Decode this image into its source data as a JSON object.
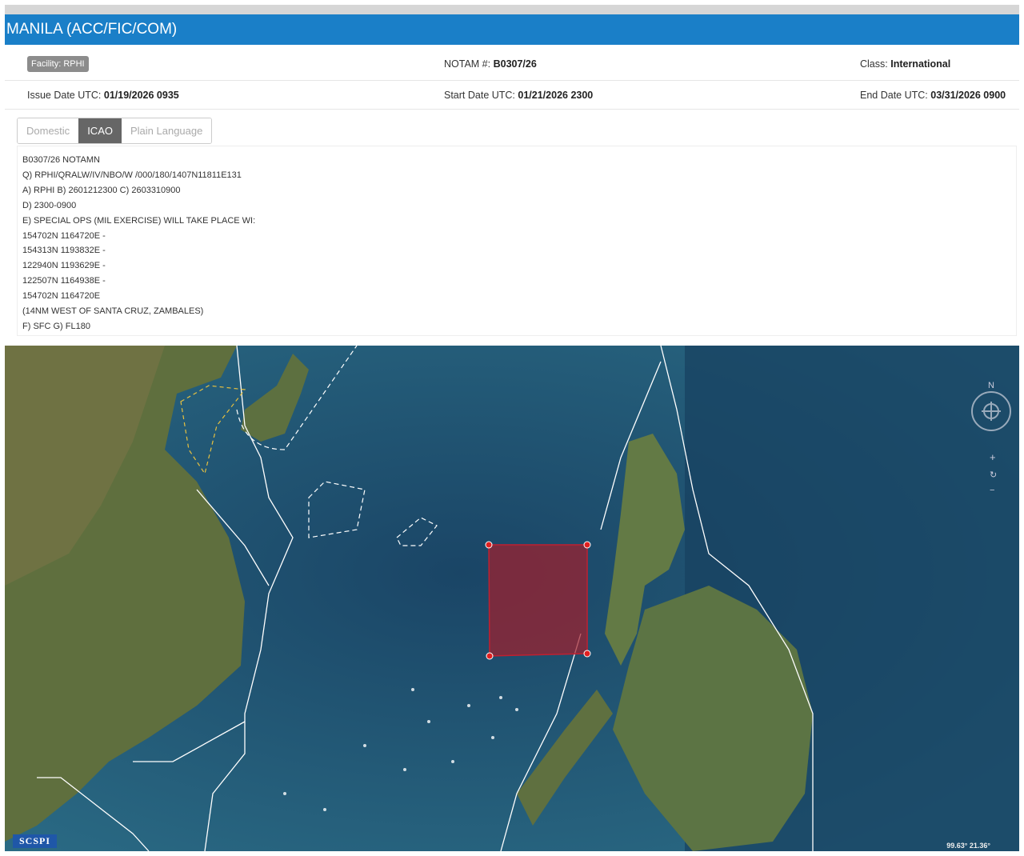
{
  "header": {
    "title": "MANILA (ACC/FIC/COM)"
  },
  "info": {
    "facility": "Facility: RPHI",
    "notam_label": "NOTAM #:",
    "notam_value": "B0307/26",
    "class_label": "Class:",
    "class_value": "International",
    "issue_label": "Issue Date UTC:",
    "issue_value": "01/19/2026 0935",
    "start_label": "Start Date UTC:",
    "start_value": "01/21/2026 2300",
    "end_label": "End Date UTC:",
    "end_value": "03/31/2026 0900"
  },
  "tabs": [
    "Domestic",
    "ICAO",
    "Plain Language"
  ],
  "notam_lines": [
    "B0307/26 NOTAMN",
    "Q) RPHI/QRALW/IV/NBO/W /000/180/1407N11811E131",
    "A) RPHI B) 2601212300 C) 2603310900",
    "D) 2300-0900",
    "E) SPECIAL OPS (MIL EXERCISE) WILL TAKE PLACE WI:",
    "154702N 1164720E -",
    "154313N 1193832E -",
    "122940N 1193629E -",
    "122507N 1164938E -",
    "154702N 1164720E",
    "(14NM WEST OF SANTA CRUZ, ZAMBALES)",
    "F) SFC G) FL180"
  ],
  "map": {
    "compass_label": "N",
    "zoom_in": "+",
    "reset": "↻",
    "zoom_out": "−",
    "coordinates": "99.63° 21.36°",
    "logo": "SCSPI",
    "zone_color": "#a3202c"
  }
}
